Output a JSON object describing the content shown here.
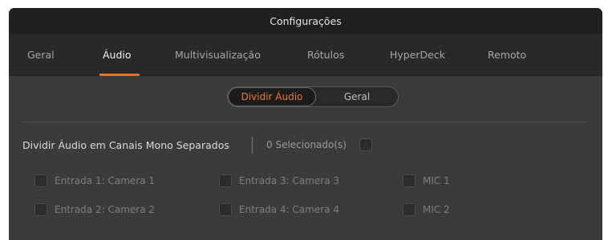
{
  "window": {
    "title": "Configurações"
  },
  "tabs": [
    {
      "label": "Geral",
      "active": false
    },
    {
      "label": "Áudio",
      "active": true
    },
    {
      "label": "Multivisualização",
      "active": false
    },
    {
      "label": "Rótulos",
      "active": false
    },
    {
      "label": "HyperDeck",
      "active": false
    },
    {
      "label": "Remoto",
      "active": false
    }
  ],
  "segmented": {
    "options": [
      {
        "label": "Dividir Áudio",
        "selected": true
      },
      {
        "label": "Geral",
        "selected": false
      }
    ]
  },
  "split_audio": {
    "label": "Dividir Áudio em Canais Mono Separados",
    "selected_count": "0 Selecionado(s)",
    "select_all_checked": false
  },
  "inputs": [
    {
      "label": "Entrada 1: Camera 1",
      "checked": false
    },
    {
      "label": "Entrada 2: Camera 2",
      "checked": false
    },
    {
      "label": "Entrada 3: Camera 3",
      "checked": false
    },
    {
      "label": "Entrada 4: Camera 4",
      "checked": false
    },
    {
      "label": "MIC 1",
      "checked": false
    },
    {
      "label": "MIC 2",
      "checked": false
    }
  ],
  "colors": {
    "accent": "#e8742b",
    "background": "#3b3b3b",
    "titlebar": "#202020",
    "tabbar": "#292929"
  }
}
